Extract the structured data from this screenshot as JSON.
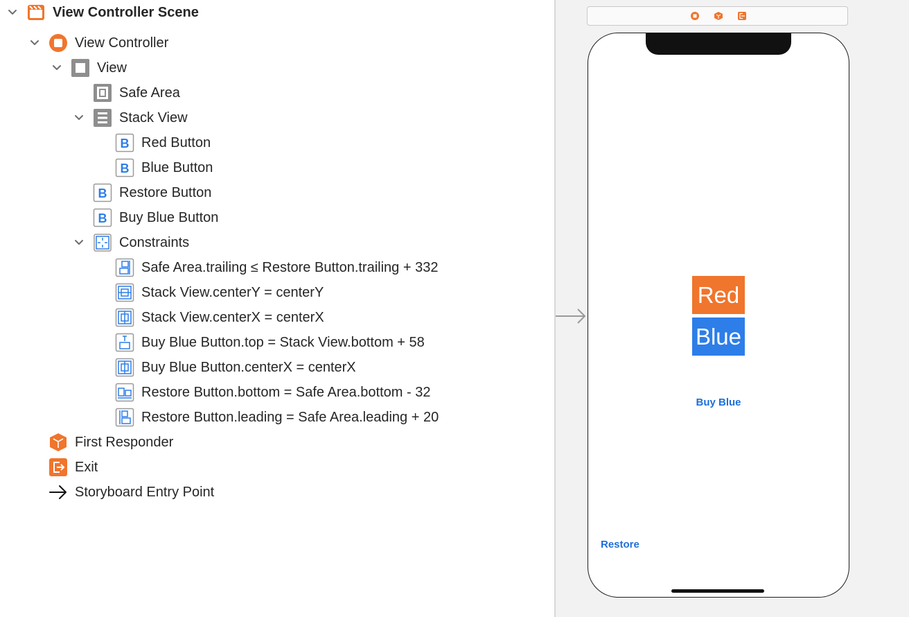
{
  "outline": {
    "rows": [
      {
        "label": "View Controller Scene",
        "icon": "scene-icon",
        "expanded": true,
        "bold": true
      },
      {
        "label": "View Controller",
        "icon": "view-controller-icon",
        "expanded": true
      },
      {
        "label": "View",
        "icon": "view-icon",
        "expanded": true
      },
      {
        "label": "Safe Area",
        "icon": "safe-area-icon"
      },
      {
        "label": "Stack View",
        "icon": "stack-view-icon",
        "expanded": true
      },
      {
        "label": "Red Button",
        "icon": "button-icon"
      },
      {
        "label": "Blue Button",
        "icon": "button-icon"
      },
      {
        "label": "Restore Button",
        "icon": "button-icon"
      },
      {
        "label": "Buy Blue Button",
        "icon": "button-icon"
      },
      {
        "label": "Constraints",
        "icon": "constraints-icon",
        "expanded": true
      },
      {
        "label": "Safe Area.trailing ≤ Restore Button.trailing + 332",
        "icon": "trailing-constraint-icon"
      },
      {
        "label": "Stack View.centerY = centerY",
        "icon": "center-constraint-icon"
      },
      {
        "label": "Stack View.centerX = centerX",
        "icon": "center-constraint-icon"
      },
      {
        "label": "Buy Blue Button.top = Stack View.bottom + 58",
        "icon": "vertical-spacing-constraint-icon"
      },
      {
        "label": "Buy Blue Button.centerX = centerX",
        "icon": "center-constraint-icon"
      },
      {
        "label": "Restore Button.bottom = Safe Area.bottom - 32",
        "icon": "bottom-constraint-icon"
      },
      {
        "label": "Restore Button.leading = Safe Area.leading + 20",
        "icon": "leading-constraint-icon"
      },
      {
        "label": "First Responder",
        "icon": "first-responder-icon"
      },
      {
        "label": "Exit",
        "icon": "exit-icon"
      },
      {
        "label": "Storyboard Entry Point",
        "icon": "entry-point-arrow-icon"
      }
    ]
  },
  "canvas": {
    "red_button": "Red",
    "blue_button": "Blue",
    "buy_button": "Buy Blue",
    "restore_button": "Restore"
  },
  "colors": {
    "accent_orange": "#f0752d",
    "button_blue": "#2d7ee8",
    "link_blue": "#1e6fd9"
  }
}
